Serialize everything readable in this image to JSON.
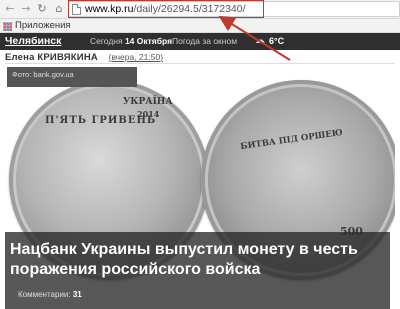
{
  "browser": {
    "url_host": "www.kp.ru",
    "url_path": "/daily/26294.5/3172340/",
    "bookmarks_label": "Приложения",
    "icons": {
      "back": "back-arrow-icon",
      "forward": "forward-arrow-icon",
      "reload": "reload-icon",
      "home": "home-icon",
      "page": "page-icon",
      "apps": "apps-grid-icon"
    },
    "highlight_color": "#c0392b"
  },
  "site_header": {
    "city": "Челябинск",
    "today_prefix": "Сегодня",
    "today_date": "14 Октября",
    "weather_label": "Погода за окном",
    "temperature": "6°C",
    "weather_icon": "cloud-rain-icon"
  },
  "article": {
    "author": "Елена КРИВЯКИНА",
    "time": "вчера, 21:50",
    "photo_credit": "Фото: bank.gov.ua",
    "coin_left": {
      "country": "УКРАЇНА",
      "year": "2014",
      "value": "П'ЯТЬ ГРИВЕНЬ"
    },
    "coin_right": {
      "inscription": "БИТВА ПІД ОРШЕЮ",
      "denomination": "500"
    },
    "headline": "Нацбанк Украины выпустил монету в честь поражения российского войска",
    "comments_label": "Комментарии:",
    "comments_count": "31"
  }
}
